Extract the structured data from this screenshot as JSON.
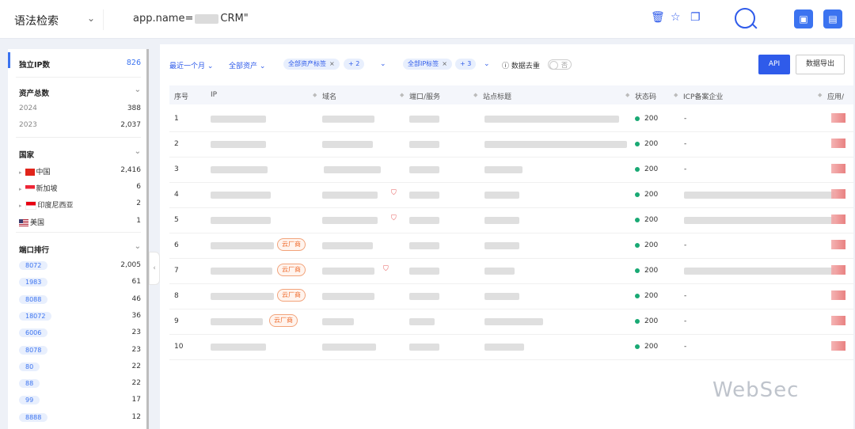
{
  "header": {
    "mode": "语法检索",
    "query_prefix": "app.name=",
    "query_suffix": "CRM\""
  },
  "sidebar": {
    "unique_ip": {
      "label": "独立IP数",
      "value": "826"
    },
    "asset_total": {
      "label": "资产总数",
      "years": [
        {
          "label": "2024",
          "value": "388"
        },
        {
          "label": "2023",
          "value": "2,037"
        }
      ]
    },
    "country": {
      "label": "国家",
      "items": [
        {
          "name": "中国",
          "value": "2,416",
          "flag": "cn"
        },
        {
          "name": "新加坡",
          "value": "6",
          "flag": "sg"
        },
        {
          "name": "印度尼西亚",
          "value": "2",
          "flag": "id"
        },
        {
          "name": "美国",
          "value": "1",
          "flag": "us"
        }
      ]
    },
    "ports": {
      "label": "端口排行",
      "items": [
        {
          "port": "8072",
          "value": "2,005"
        },
        {
          "port": "1983",
          "value": "61"
        },
        {
          "port": "8088",
          "value": "46"
        },
        {
          "port": "18072",
          "value": "36"
        },
        {
          "port": "6006",
          "value": "23"
        },
        {
          "port": "8078",
          "value": "23"
        },
        {
          "port": "80",
          "value": "22"
        },
        {
          "port": "88",
          "value": "22"
        },
        {
          "port": "99",
          "value": "17"
        },
        {
          "port": "8888",
          "value": "12"
        }
      ]
    }
  },
  "filters": {
    "time": "最近一个月",
    "assets": "全部资产",
    "asset_tag": "全部资产标签",
    "asset_tag_more": "+ 2",
    "ip_tag": "全部IP标签",
    "ip_tag_more": "+ 3",
    "dedup": "数据去重",
    "toggle": "否",
    "api": "API",
    "export": "数据导出"
  },
  "table": {
    "headers": [
      "序号",
      "IP",
      "域名",
      "端口/服务",
      "站点标题",
      "状态码",
      "ICP备案企业",
      "应用/"
    ],
    "rows": [
      {
        "n": "1",
        "status": "200",
        "icp": "-",
        "cloud": ""
      },
      {
        "n": "2",
        "status": "200",
        "icp": "-",
        "cloud": ""
      },
      {
        "n": "3",
        "status": "200",
        "icp": "-",
        "cloud": ""
      },
      {
        "n": "4",
        "status": "200",
        "icp": "",
        "cloud": ""
      },
      {
        "n": "5",
        "status": "200",
        "icp": "",
        "cloud": ""
      },
      {
        "n": "6",
        "status": "200",
        "icp": "-",
        "cloud": "云厂商"
      },
      {
        "n": "7",
        "status": "200",
        "icp": "",
        "cloud": "云厂商"
      },
      {
        "n": "8",
        "status": "200",
        "icp": "-",
        "cloud": "云厂商"
      },
      {
        "n": "9",
        "status": "200",
        "icp": "-",
        "cloud": "云厂商"
      },
      {
        "n": "10",
        "status": "200",
        "icp": "-",
        "cloud": ""
      }
    ]
  },
  "watermark": "WebSec"
}
